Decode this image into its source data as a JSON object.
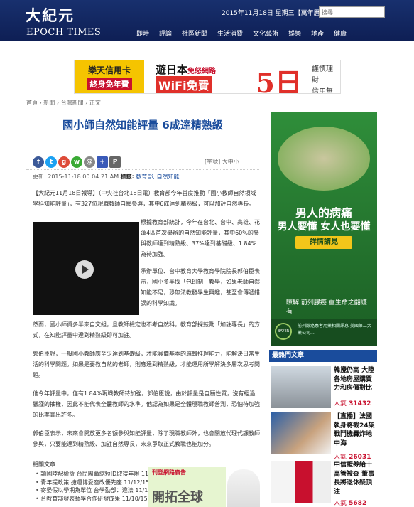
{
  "header": {
    "logo_cn": "大紀元",
    "logo_en": "EPOCH TIMES",
    "date": "2015年11月18日 星期三【萬年曆】",
    "search_placeholder": "搜尋",
    "nav": [
      "即時",
      "評論",
      "社區新聞",
      "生活消費",
      "文化藝術",
      "娛樂",
      "地產",
      "健康"
    ]
  },
  "ad_banner": {
    "card1": "樂天信用卡",
    "card2": "終身免年費",
    "travel": "遊日本",
    "travel_sub": "免怒網路",
    "wifi": "WiFi免費",
    "days": "5日",
    "side": "謹慎理財\n信用無價"
  },
  "breadcrumb": "首頁 › 新聞 › 台灣新聞 › 正文",
  "article": {
    "title": "國小師自然知能評量 6成達精熟級",
    "font_size_label": "[字號] 大中小",
    "meta_date": "更新: 2015-11-18 00:04:21 AM",
    "meta_tag_label": "標籤:",
    "meta_tags": "教育部, 自然知能",
    "p1": "【大紀元11月18日報導】（中央社台北18日電）教育部今年首度推動「國小教師自然領域學科知能評量」，有327位現職教師自願參與，其中6成達到精熟級，可以加註自然專長。",
    "p2": "根據教育部統計，今年在台北、台中、高雄、花蓮4區首次舉辦的自然知能評量，其中60%的參與教師達到精熟級、37%達到基礎級、1.84%為待加強。",
    "p3": "承辦單位、台中教育大學教育學院院長郭伯臣表示，國小多半採「包班制」教學，如果老師自然知能不足，恐無法教發學生興趣，甚至會傳遞錯誤的科學知識。",
    "p4": "然而，國小師資多半來自文組，且教師檢定也不考自然科，教育部採鼓勵「加註專長」的方式，在知能評量中達到精熟級即可加註。",
    "p5": "郭伯臣說，一般國小教師應至少達到基礎級，才能具備基本的邏輯推理能力，能解決日常生活的科學問題。如果是要教自然的老師，則應達到精熟級，才能運用所學解決多層次思考問題。",
    "p6": "他今年評量中，僅有1.84%現職教師待加強。郭伯臣說，由於評量是自願性質，沒有經過嚴謹的抽樣，因此不能代表全體教師的水準。他認為如果是全體現職教師普測，恐怕待加強的比率高出許多。",
    "p7": "郭伯臣表示，未來會開放更多名額參與知能評量，除了現職教師外，也會開放代理代課教師參與，只要能達到精熟級、加註自然專長，未來爭取正式教職也能加分。"
  },
  "related": {
    "title": "相關文章",
    "items": [
      "讀國陸配權益 台民團籲縮短ID取得年限 11",
      "青年提政策 捷運博愛座改優先座 11/12/15",
      "寄晏假以學期為單位 台學勤部：違法 11/1",
      "台教育部發表藝學合作研發成果 11/10/15"
    ]
  },
  "ad_small": {
    "top": "刊登網路廣告",
    "big": "開拓全球"
  },
  "side_ad": {
    "headline1": "男人的病痛",
    "headline2": "男人要懂 女人也要懂",
    "button": "詳情請見",
    "small": "瞭解 前列腺癌 重生命之翻護有",
    "footer": "前列腺癌患者用藥相關訊息 美國第二大藥公司..."
  },
  "popular": {
    "header": "最熱門文章",
    "items": [
      {
        "title": "韓攪仍高 大陸各地房屋購買力和房價對比",
        "views_label": "人氣",
        "views": "31432"
      },
      {
        "title": "【直播】法國執身將截24架戰鬥機轟炸地中海",
        "views_label": "人氣",
        "views": "26031"
      },
      {
        "title": "中信證券給十高管被查 董事長將退休疑頂注",
        "views_label": "人氣",
        "views": "5682"
      }
    ]
  }
}
